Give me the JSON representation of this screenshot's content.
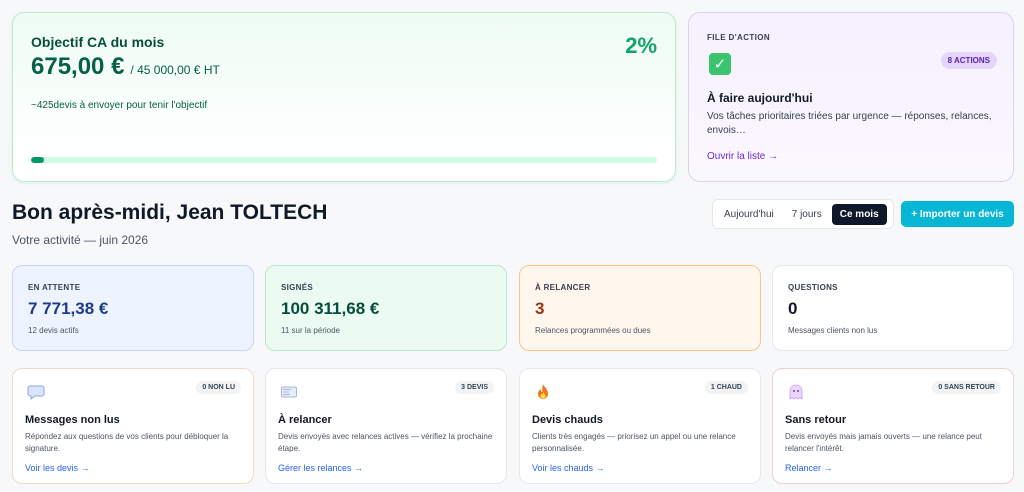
{
  "objective": {
    "title": "Objectif CA du mois",
    "amount": "675,00 €",
    "target": "/ 45 000,00 € HT",
    "note": "~425devis à envoyer pour tenir l'objectif",
    "percent": "2%",
    "progress_fraction": 0.02,
    "colors": {
      "accent": "#059669",
      "percent": "#10a36a"
    }
  },
  "action_file": {
    "kicker": "FILE D'ACTION",
    "badge": "8 ACTIONS",
    "icon": "check-box-icon",
    "title": "À faire aujourd'hui",
    "description": "Vos tâches prioritaires triées par urgence — réponses, relances, envois…",
    "link": "Ouvrir la liste →",
    "colors": {
      "link": "#6d28d9",
      "badge_bg": "#e4d5fb"
    }
  },
  "greeting": {
    "title": "Bon après-midi, Jean TOLTECH",
    "subtitle": "Votre activité — juin 2026"
  },
  "period": {
    "options": [
      "Aujourd'hui",
      "7 jours",
      "Ce mois"
    ],
    "selected": "Ce mois"
  },
  "import_button": "+ Importer un devis",
  "stats": [
    {
      "label": "EN ATTENTE",
      "value": "7 771,38 €",
      "sub": "12 devis actifs"
    },
    {
      "label": "SIGNÉS",
      "value": "100 311,68 €",
      "sub": "11 sur la période"
    },
    {
      "label": "À RELANCER",
      "value": "3",
      "sub": "Relances programmées ou dues"
    },
    {
      "label": "QUESTIONS",
      "value": "0",
      "sub": "Messages clients non lus"
    }
  ],
  "tasks": [
    {
      "icon": "speech-bubble-icon",
      "badge": "0 NON LU",
      "title": "Messages non lus",
      "desc": "Répondez aux questions de vos clients pour débloquer la signature.",
      "link": "Voir les devis →"
    },
    {
      "icon": "envelope-icon",
      "badge": "3 DEVIS",
      "title": "À relancer",
      "desc": "Devis envoyés avec relances actives — vérifiez la prochaine étape.",
      "link": "Gérer les relances →"
    },
    {
      "icon": "flame-icon",
      "badge": "1 CHAUD",
      "title": "Devis chauds",
      "desc": "Clients très engagés — priorisez un appel ou une relance personnalisée.",
      "link": "Voir les chauds →"
    },
    {
      "icon": "ghost-icon",
      "badge": "0 SANS RETOUR",
      "title": "Sans retour",
      "desc": "Devis envoyés mais jamais ouverts — une relance peut relancer l'intérêt.",
      "link": "Relancer →"
    }
  ]
}
